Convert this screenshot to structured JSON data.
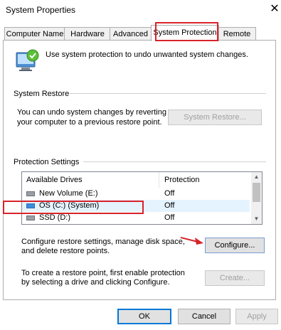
{
  "window": {
    "title": "System Properties",
    "close_glyph": "✕"
  },
  "tabs": [
    {
      "label": "Computer Name",
      "active": false
    },
    {
      "label": "Hardware",
      "active": false
    },
    {
      "label": "Advanced",
      "active": false
    },
    {
      "label": "System Protection",
      "active": true
    },
    {
      "label": "Remote",
      "active": false
    }
  ],
  "intro": {
    "text": "Use system protection to undo unwanted system changes.",
    "icon": "system-protection-icon"
  },
  "system_restore": {
    "heading": "System Restore",
    "line1": "You can undo system changes by reverting",
    "line2": "your computer to a previous restore point.",
    "button": "System Restore...",
    "button_enabled": false
  },
  "protection_settings": {
    "heading": "Protection Settings",
    "columns": [
      "Available Drives",
      "Protection"
    ],
    "drives": [
      {
        "name": "New Volume (E:)",
        "protection": "Off",
        "selected": false,
        "icon": "drive-icon"
      },
      {
        "name": "OS (C:) (System)",
        "protection": "Off",
        "selected": true,
        "icon": "os-drive-icon"
      },
      {
        "name": "SSD (D:)",
        "protection": "Off",
        "selected": false,
        "icon": "drive-icon"
      }
    ]
  },
  "configure": {
    "line1": "Configure restore settings, manage disk space,",
    "line2": "and delete restore points.",
    "button": "Configure..."
  },
  "create": {
    "line1": "To create a restore point, first enable protection",
    "line2": "by selecting a drive and clicking Configure.",
    "button": "Create...",
    "button_enabled": false
  },
  "footer": {
    "ok": "OK",
    "cancel": "Cancel",
    "apply": "Apply",
    "apply_enabled": false
  },
  "colors": {
    "highlight_box": "#d9232b",
    "selected_row": "#e5f3ff"
  }
}
